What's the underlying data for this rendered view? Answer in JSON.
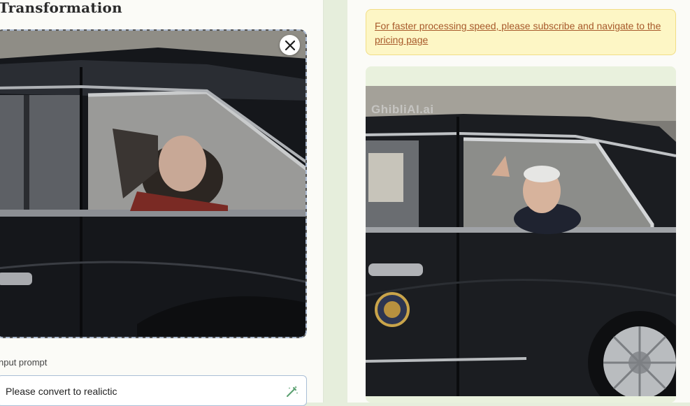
{
  "left": {
    "title": "Transformation",
    "prompt_label": "nput prompt",
    "prompt_value": "Please convert to realictic"
  },
  "right": {
    "notice": "For faster processing speed, please subscribe and navigate to the pricing page",
    "watermark": "GhibliAI.ai"
  }
}
